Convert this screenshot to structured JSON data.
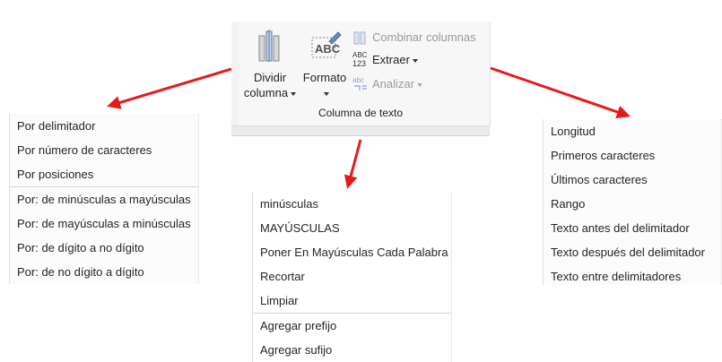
{
  "ribbon": {
    "split_column": {
      "line1": "Dividir",
      "line2": "columna",
      "icon": "split-column-icon"
    },
    "format": {
      "label": "Formato",
      "icon": "abc-format-icon"
    },
    "merge_columns": {
      "label": "Combinar columnas",
      "icon": "merge-columns-icon",
      "enabled": false
    },
    "extract": {
      "label": "Extraer",
      "icon": "abc-123-extract-icon",
      "enabled": true
    },
    "parse": {
      "label": "Analizar",
      "icon": "parse-icon",
      "enabled": false
    },
    "group_label": "Columna de texto"
  },
  "menus": {
    "split": {
      "items": [
        "Por delimitador",
        "Por número de caracteres",
        "Por posiciones",
        "Por: de minúsculas a mayúsculas",
        "Por: de mayúsculas a minúsculas",
        "Por: de dígito a no dígito",
        "Por: de no dígito a dígito"
      ]
    },
    "format": {
      "items": [
        "minúsculas",
        "MAYÚSCULAS",
        "Poner En Mayúsculas Cada Palabra",
        "Recortar",
        "Limpiar",
        "Agregar prefijo",
        "Agregar sufijo"
      ]
    },
    "extract": {
      "items": [
        "Longitud",
        "Primeros caracteres",
        "Últimos caracteres",
        "Rango",
        "Texto antes del delimitador",
        "Texto después del delimitador",
        "Texto entre delimitadores"
      ]
    }
  },
  "colors": {
    "arrow": "#e8191a",
    "disabled_text": "#9a9a9a"
  }
}
